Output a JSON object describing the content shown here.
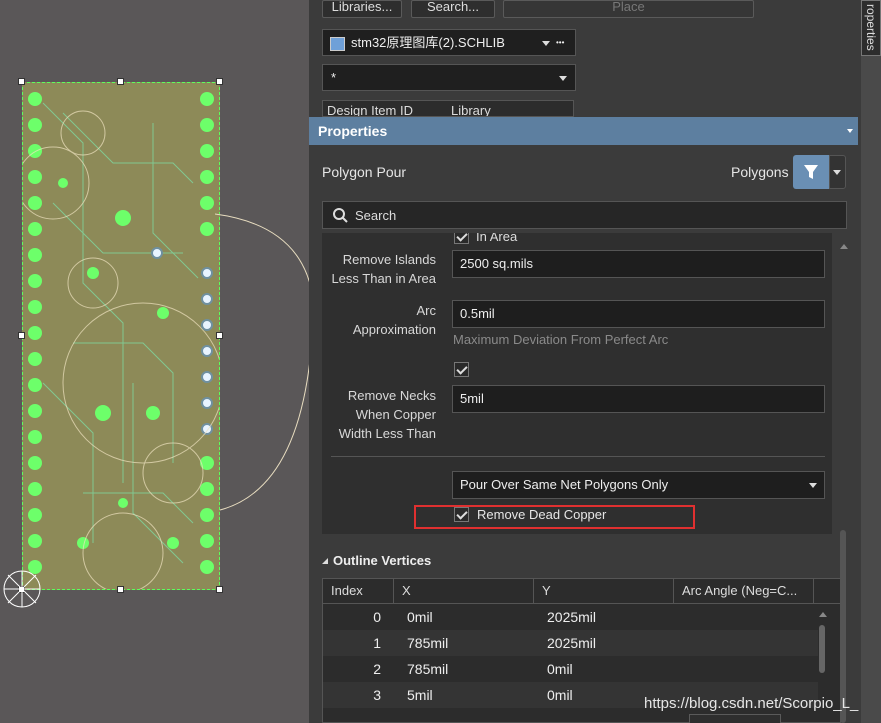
{
  "toolbar": {
    "libraries": "Libraries...",
    "search": "Search...",
    "place": "Place"
  },
  "library": {
    "selected": "stm32原理图库(2).SCHLIB",
    "more": "•••",
    "filter": "*"
  },
  "columns": {
    "design_item": "Design Item ID",
    "library": "Library"
  },
  "side_tab": "roperties",
  "properties": {
    "title": "Properties",
    "object_type": "Polygon Pour",
    "filter_label": "Polygons",
    "search_placeholder": "Search"
  },
  "pour": {
    "cut_label": "In Area",
    "islands_label_1": "Remove Islands",
    "islands_label_2": "Less Than in Area",
    "islands_value": "2500 sq.mils",
    "arc_label_1": "Arc",
    "arc_label_2": "Approximation",
    "arc_value": "0.5mil",
    "arc_hint": "Maximum Deviation From Perfect Arc",
    "necks_label_1": "Remove Necks",
    "necks_label_2": "When Copper",
    "necks_label_3": "Width Less Than",
    "necks_value": "5mil",
    "pour_over": "Pour Over Same Net Polygons Only",
    "dead_copper": "Remove Dead Copper"
  },
  "vertices": {
    "section": "Outline Vertices",
    "headers": [
      "Index",
      "X",
      "Y",
      "Arc Angle (Neg=C..."
    ],
    "rows": [
      {
        "index": "0",
        "x": "0mil",
        "y": "2025mil"
      },
      {
        "index": "1",
        "x": "785mil",
        "y": "2025mil"
      },
      {
        "index": "2",
        "x": "785mil",
        "y": "0mil"
      },
      {
        "index": "3",
        "x": "5mil",
        "y": "0mil"
      }
    ]
  },
  "watermark": "https://blog.csdn.net/Scorpio_L_",
  "colors": {
    "accent": "#5d7fa0",
    "highlight": "#e03030",
    "panel": "#3b3b3b",
    "copper": "#7dff6a"
  }
}
